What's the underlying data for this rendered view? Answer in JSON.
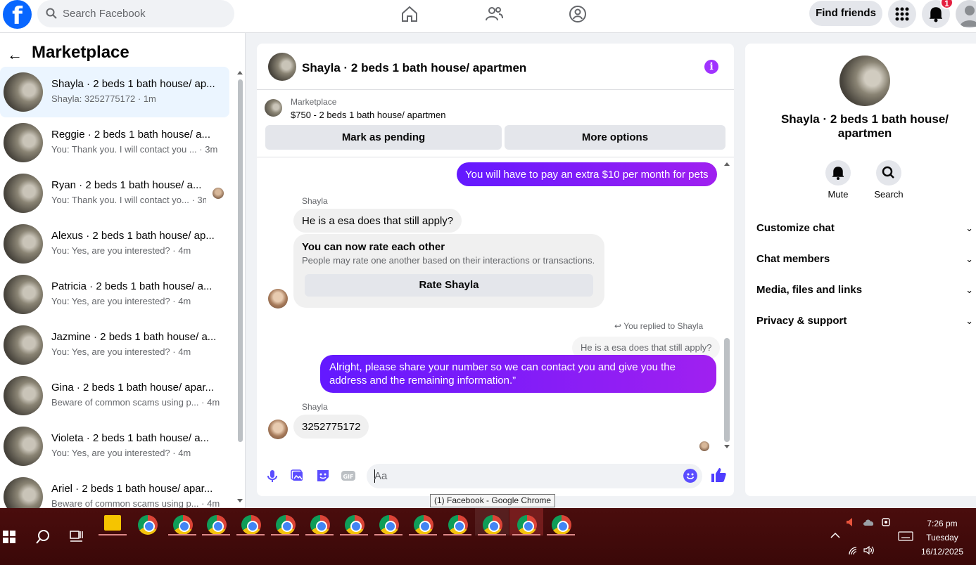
{
  "topbar": {
    "logo_letter": "f",
    "search_placeholder": "Search Facebook",
    "find_friends": "Find friends",
    "notifications_count": "1"
  },
  "sidebar": {
    "title": "Marketplace",
    "conversations": [
      {
        "title": "Shayla · 2 beds 1 bath house/ ap...",
        "sub": "Shayla: 3252775172 · 1m"
      },
      {
        "title": "Reggie · 2 beds 1 bath house/ a...",
        "sub": "You: Thank you. I will contact you ... · 3m"
      },
      {
        "title": "Ryan · 2 beds 1 bath house/ a...",
        "sub": "You: Thank you. I will contact yo... · 3m"
      },
      {
        "title": "Alexus · 2 beds 1 bath house/ ap...",
        "sub": "You: Yes, are you interested? · 4m"
      },
      {
        "title": "Patricia · 2 beds 1 bath house/ a...",
        "sub": "You: Yes, are you interested? · 4m"
      },
      {
        "title": "Jazmine · 2 beds 1 bath house/ a...",
        "sub": "You: Yes, are you interested? · 4m"
      },
      {
        "title": "Gina · 2 beds 1 bath house/ apar...",
        "sub": "Beware of common scams using p... · 4m"
      },
      {
        "title": "Violeta · 2 beds 1 bath house/ a...",
        "sub": "You: Yes, are you interested? · 4m"
      },
      {
        "title": "Ariel · 2 beds 1 bath house/ apar...",
        "sub": "Beware of common scams using p... · 4m"
      }
    ]
  },
  "chat": {
    "title": "Shayla · 2 beds 1 bath house/ apartmen",
    "listing_kind": "Marketplace",
    "listing_price": "$750 - 2 beds 1 bath house/ apartmen",
    "mark_pending": "Mark as pending",
    "more_options": "More options",
    "msg_out_1": "You will have to pay an extra $10 per month for pets",
    "sender_1": "Shayla",
    "msg_in_1": "He is a esa does that still apply?",
    "rate_title": "You can now rate each other",
    "rate_text": "People may rate one another based on their interactions or transactions.",
    "rate_button": "Rate Shayla",
    "reply_note": "You replied to Shayla",
    "quoted": "He is a esa does that still apply?",
    "msg_out_2": "Alright, please share your number so we can contact you and give you the address and the remaining information.”",
    "sender_2": "Shayla",
    "msg_in_2": "3252775172",
    "composer_placeholder": "Aa"
  },
  "tooltip": "(1) Facebook - Google Chrome",
  "right_panel": {
    "title": "Shayla · 2 beds 1 bath house/ apartmen",
    "mute": "Mute",
    "search": "Search",
    "rows": [
      "Customize chat",
      "Chat members",
      "Media, files and links",
      "Privacy & support"
    ]
  },
  "taskbar": {
    "time": "7:26 pm",
    "day": "Tuesday",
    "date": "16/12/2025"
  },
  "colors": {
    "brand": "#0866ff",
    "outgoing_start": "#6319ff",
    "outgoing_end": "#a020f0",
    "info": "#a033ff"
  }
}
